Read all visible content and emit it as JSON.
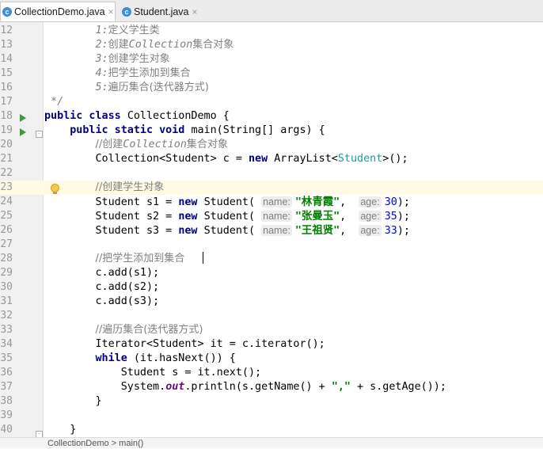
{
  "tabs": [
    {
      "label": "CollectionDemo.java",
      "icon": "java-class-icon",
      "close": "×"
    },
    {
      "label": "Student.java",
      "icon": "java-class-icon",
      "close": "×"
    }
  ],
  "editor": {
    "lines": [
      {
        "n": "12",
        "parts": [
          [
            "",
            "        "
          ],
          [
            "cm",
            "1:"
          ],
          [
            "cmz",
            "定义学生类"
          ]
        ]
      },
      {
        "n": "13",
        "parts": [
          [
            "",
            "        "
          ],
          [
            "cm",
            "2:"
          ],
          [
            "cmz",
            "创建"
          ],
          [
            "cm",
            "Collection"
          ],
          [
            "cmz",
            "集合对象"
          ]
        ]
      },
      {
        "n": "14",
        "parts": [
          [
            "",
            "        "
          ],
          [
            "cm",
            "3:"
          ],
          [
            "cmz",
            "创建学生对象"
          ]
        ]
      },
      {
        "n": "15",
        "parts": [
          [
            "",
            "        "
          ],
          [
            "cm",
            "4:"
          ],
          [
            "cmz",
            "把学生添加到集合"
          ]
        ]
      },
      {
        "n": "16",
        "parts": [
          [
            "",
            "        "
          ],
          [
            "cm",
            "5:"
          ],
          [
            "cmz",
            "遍历集合(迭代器方式)"
          ]
        ]
      },
      {
        "n": "17",
        "parts": [
          [
            "cm",
            " */"
          ]
        ]
      },
      {
        "n": "18",
        "parts": [
          [
            "kw",
            "public class "
          ],
          [
            "",
            "CollectionDemo {"
          ]
        ]
      },
      {
        "n": "19",
        "parts": [
          [
            "",
            "    "
          ],
          [
            "kw",
            "public static void "
          ],
          [
            "",
            "main(String[] args) {"
          ]
        ]
      },
      {
        "n": "20",
        "parts": [
          [
            "",
            "        "
          ],
          [
            "cmz",
            "//创建"
          ],
          [
            "cm",
            "Collection"
          ],
          [
            "cmz",
            "集合对象"
          ]
        ]
      },
      {
        "n": "21",
        "parts": [
          [
            "",
            "        Collection<Student> c = "
          ],
          [
            "kw",
            "new "
          ],
          [
            "",
            "ArrayList<"
          ],
          [
            "ty",
            "Student"
          ],
          [
            "",
            ">();"
          ]
        ]
      },
      {
        "n": "22",
        "parts": []
      },
      {
        "n": "23",
        "parts": [
          [
            "",
            "        "
          ],
          [
            "cmz",
            "//创建学生对象"
          ]
        ]
      },
      {
        "n": "24",
        "parts": [
          [
            "",
            "        Student s1 = "
          ],
          [
            "kw",
            "new "
          ],
          [
            "",
            "Student( "
          ],
          [
            "hint",
            "name:"
          ],
          [
            "st",
            "\"林青霞\""
          ],
          [
            "",
            ",  "
          ],
          [
            "hint",
            "age:"
          ],
          [
            "nm",
            "30"
          ],
          [
            "",
            ");"
          ]
        ]
      },
      {
        "n": "25",
        "parts": [
          [
            "",
            "        Student s2 = "
          ],
          [
            "kw",
            "new "
          ],
          [
            "",
            "Student( "
          ],
          [
            "hint",
            "name:"
          ],
          [
            "st",
            "\"张曼玉\""
          ],
          [
            "",
            ",  "
          ],
          [
            "hint",
            "age:"
          ],
          [
            "nm",
            "35"
          ],
          [
            "",
            ");"
          ]
        ]
      },
      {
        "n": "26",
        "parts": [
          [
            "",
            "        Student s3 = "
          ],
          [
            "kw",
            "new "
          ],
          [
            "",
            "Student( "
          ],
          [
            "hint",
            "name:"
          ],
          [
            "st",
            "\"王祖贤\""
          ],
          [
            "",
            ",  "
          ],
          [
            "hint",
            "age:"
          ],
          [
            "nm",
            "33"
          ],
          [
            "",
            ");"
          ]
        ]
      },
      {
        "n": "27",
        "parts": []
      },
      {
        "n": "28",
        "parts": [
          [
            "",
            "        "
          ],
          [
            "cmz",
            "//把学生添加到集合"
          ]
        ]
      },
      {
        "n": "29",
        "parts": [
          [
            "",
            "        c.add(s1);"
          ]
        ]
      },
      {
        "n": "30",
        "parts": [
          [
            "",
            "        c.add(s2);"
          ]
        ]
      },
      {
        "n": "31",
        "parts": [
          [
            "",
            "        c.add(s3);"
          ]
        ]
      },
      {
        "n": "32",
        "parts": []
      },
      {
        "n": "33",
        "parts": [
          [
            "",
            "        "
          ],
          [
            "cmz",
            "//遍历集合(迭代器方式)"
          ]
        ]
      },
      {
        "n": "34",
        "parts": [
          [
            "",
            "        Iterator<Student> it = c.iterator();"
          ]
        ]
      },
      {
        "n": "35",
        "parts": [
          [
            "",
            "        "
          ],
          [
            "kw",
            "while "
          ],
          [
            "",
            "(it.hasNext()) {"
          ]
        ]
      },
      {
        "n": "36",
        "parts": [
          [
            "",
            "            Student s = it.next();"
          ]
        ]
      },
      {
        "n": "37",
        "parts": [
          [
            "",
            "            System."
          ],
          [
            "fld",
            "out"
          ],
          [
            "",
            ".println(s.getName() + "
          ],
          [
            "st",
            "\",\""
          ],
          [
            "",
            " + s.getAge());"
          ]
        ]
      },
      {
        "n": "38",
        "parts": [
          [
            "",
            "        }"
          ]
        ]
      },
      {
        "n": "39",
        "parts": []
      },
      {
        "n": "40",
        "parts": [
          [
            "",
            "    }"
          ]
        ]
      }
    ]
  },
  "status": {
    "breadcrumb": "CollectionDemo  >  main()"
  }
}
